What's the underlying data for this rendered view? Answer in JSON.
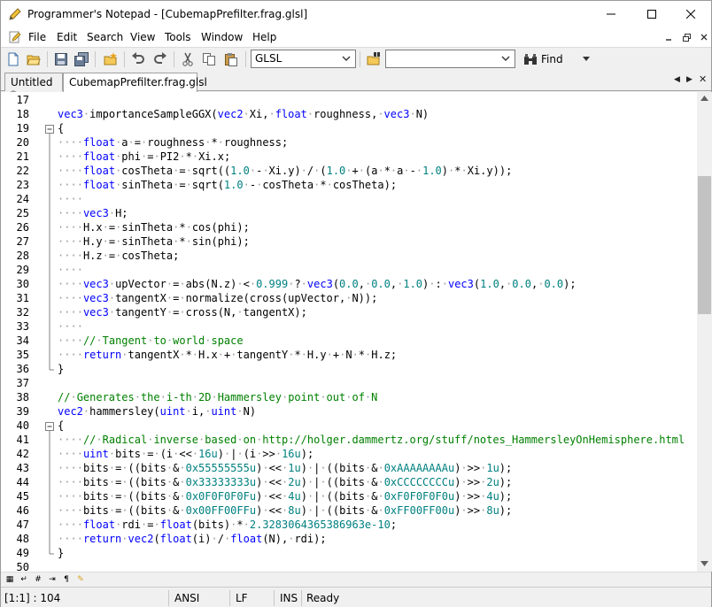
{
  "title_bar": {
    "title": "Programmer's Notepad - [CubemapPrefilter.frag.glsl]"
  },
  "menu": [
    "File",
    "Edit",
    "Search",
    "View",
    "Tools",
    "Window",
    "Help"
  ],
  "toolbar": {
    "scheme": "GLSL",
    "find_label": "Find",
    "find_value": ""
  },
  "tabs": [
    {
      "label": "Untitled *",
      "active": false
    },
    {
      "label": "CubemapPrefilter.frag.glsl",
      "active": true
    }
  ],
  "code": {
    "line_numbers": [
      "17",
      "18",
      "19",
      "20",
      "21",
      "22",
      "23",
      "24",
      "25",
      "26",
      "27",
      "28",
      "29",
      "30",
      "31",
      "32",
      "33",
      "34",
      "35",
      "36",
      "37",
      "38",
      "39",
      "40",
      "41",
      "42",
      "43",
      "44",
      "45",
      "46",
      "47",
      "48",
      "49",
      "50"
    ],
    "lines": [
      "",
      "vec3·importanceSampleGGX(vec2·Xi,·float·roughness,·vec3·N)",
      "{",
      "····float·a·=·roughness·*·roughness;",
      "····float·phi·=·PI2·*·Xi.x;",
      "····float·cosTheta·=·sqrt((1.0·-·Xi.y)·/·(1.0·+·(a·*·a·-·1.0)·*·Xi.y));",
      "····float·sinTheta·=·sqrt(1.0·-·cosTheta·*·cosTheta);",
      "····",
      "····vec3·H;",
      "····H.x·=·sinTheta·*·cos(phi);",
      "····H.y·=·sinTheta·*·sin(phi);",
      "····H.z·=·cosTheta;",
      "····",
      "····vec3·upVector·=·abs(N.z)·<·0.999·?·vec3(0.0,·0.0,·1.0)·:·vec3(1.0,·0.0,·0.0);",
      "····vec3·tangentX·=·normalize(cross(upVector,·N));",
      "····vec3·tangentY·=·cross(N,·tangentX);",
      "····",
      "····//·Tangent·to·world·space",
      "····return·tangentX·*·H.x·+·tangentY·*·H.y·+·N·*·H.z;",
      "}",
      "",
      "//·Generates·the·i-th·2D·Hammersley·point·out·of·N",
      "vec2·hammersley(uint·i,·uint·N)",
      "{",
      "····//·Radical·inverse·based·on·http://holger.dammertz.org/stuff/notes_HammersleyOnHemisphere.html",
      "····uint·bits·=·(i·<<·16u)·|·(i·>>·16u);",
      "····bits·=·((bits·&·0x55555555u)·<<·1u)·|·((bits·&·0xAAAAAAAAu)·>>·1u);",
      "····bits·=·((bits·&·0x33333333u)·<<·2u)·|·((bits·&·0xCCCCCCCCu)·>>·2u);",
      "····bits·=·((bits·&·0x0F0F0F0Fu)·<<·4u)·|·((bits·&·0xF0F0F0F0u)·>>·4u);",
      "····bits·=·((bits·&·0x00FF00FFu)·<<·8u)·|·((bits·&·0xFF00FF00u)·>>·8u);",
      "····float·rdi·=·float(bits)·*·2.3283064365386963e-10;",
      "····return·vec2(float(i)·/·float(N),·rdi);",
      "}",
      ""
    ]
  },
  "status": {
    "position": "[1:1] : 104",
    "encoding": "ANSI",
    "line_ending": "LF",
    "insert_mode": "INS",
    "state": "Ready"
  },
  "colors": {
    "keyword": "#0000ff",
    "number": "#008080",
    "comment": "#008000",
    "whitespace": "#9a9a9a"
  }
}
